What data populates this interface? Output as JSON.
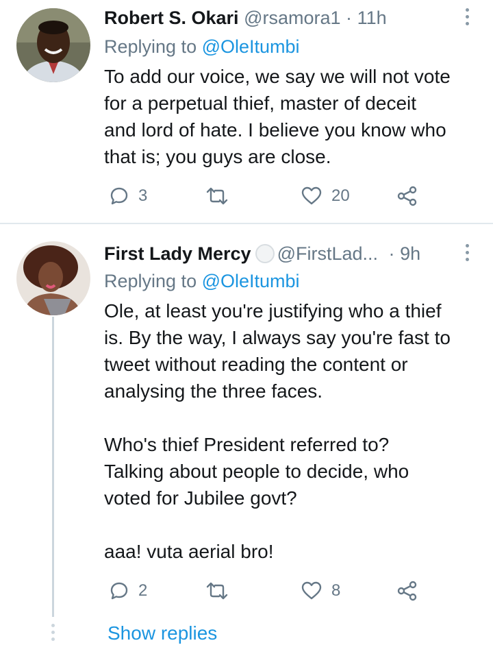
{
  "tweets": [
    {
      "name": "Robert S. Okari",
      "handle": "@rsamora1",
      "sep": "·",
      "time": "11h",
      "replying_prefix": "Replying to ",
      "replying_to": "@OleItumbi",
      "text": "To add our voice, we say we will not vote\nfor a perpetual thief, master of deceit\nand lord of hate. I believe you know who\nthat is; you guys are close.",
      "replies": "3",
      "retweets": "",
      "likes": "20"
    },
    {
      "name": "First Lady Mercy",
      "handle": "@FirstLad...",
      "sep": "·",
      "time": "9h",
      "replying_prefix": "Replying to ",
      "replying_to": "@OleItumbi",
      "text": "Ole, at least you're justifying who a thief\nis. By the way, I always say you're fast to\ntweet without reading the content or\nanalysing the three faces.\n\nWho's thief President referred to?\nTalking about people to decide, who\nvoted for Jubilee govt?\n\naaa! vuta aerial bro!",
      "replies": "2",
      "retweets": "",
      "likes": "8"
    }
  ],
  "show_replies": "Show replies",
  "icons": {
    "reply": "reply-icon",
    "retweet": "retweet-icon",
    "like": "heart-icon",
    "share": "share-icon",
    "more": "more-options-icon"
  },
  "colors": {
    "link": "#1b95e0",
    "secondary": "#657786",
    "text": "#14171a",
    "thread_line": "#ccd6dd"
  }
}
